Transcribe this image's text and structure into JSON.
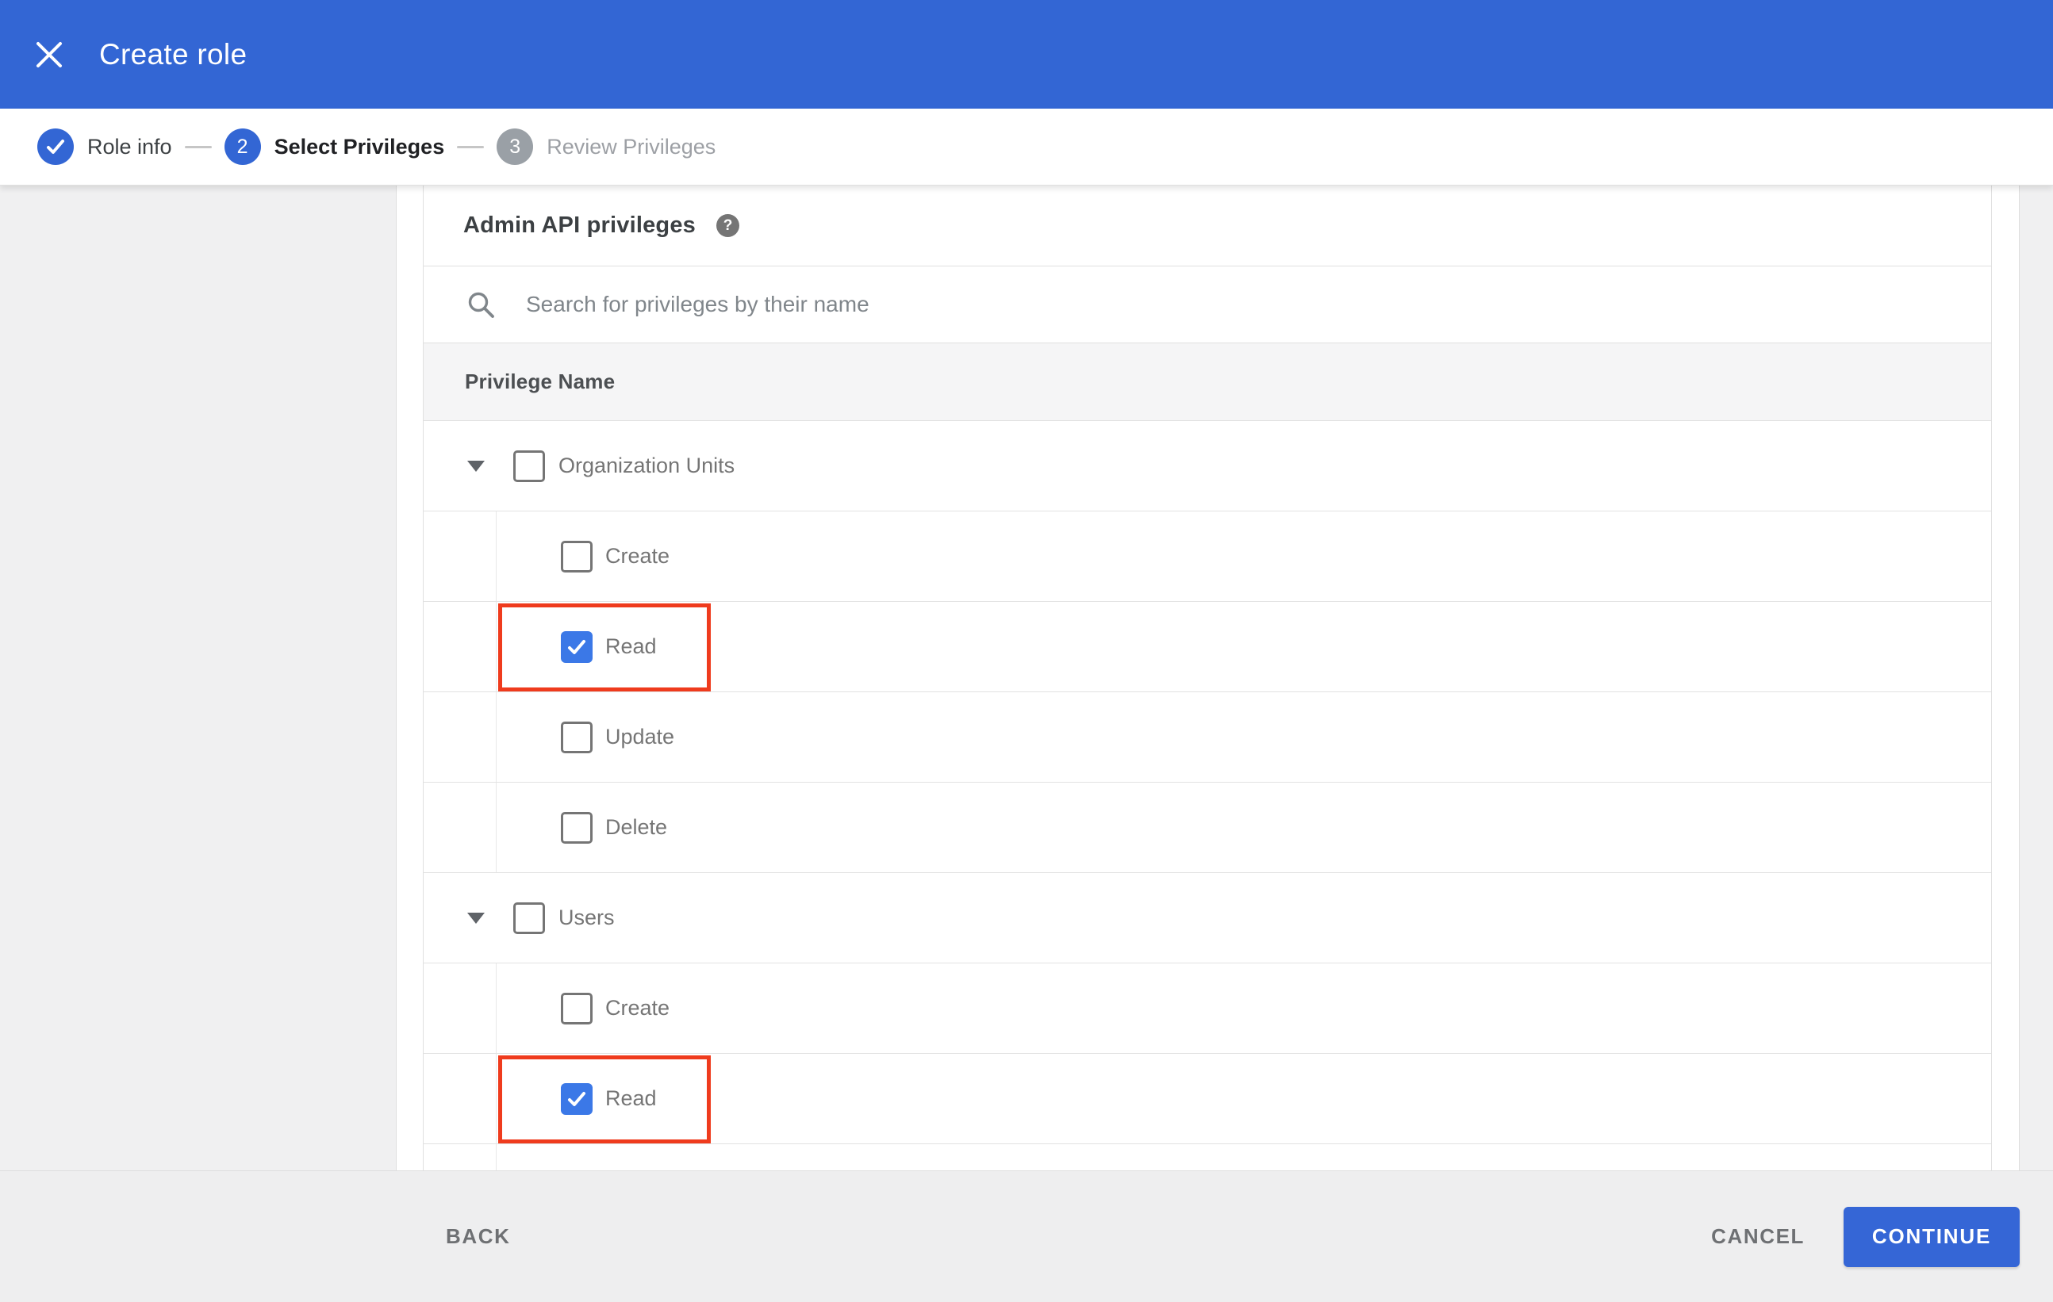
{
  "appbar": {
    "title": "Create role",
    "close_icon": "x-close",
    "background_color": "#3366d4"
  },
  "stepper": {
    "steps": [
      {
        "label": "Role info",
        "status": "done",
        "indicator": "check"
      },
      {
        "label": "Select Privileges",
        "status": "active",
        "number": "2"
      },
      {
        "label": "Review Privileges",
        "status": "upcoming",
        "number": "3"
      }
    ]
  },
  "panel": {
    "heading": "Admin API privileges",
    "help_icon": "?",
    "search": {
      "placeholder": "Search for privileges by their name",
      "value": "",
      "icon": "magnifier"
    },
    "column_header": "Privilege Name",
    "rows": [
      {
        "label": "Organization Units",
        "type": "parent",
        "expanded": true,
        "checked": false
      },
      {
        "label": "Create",
        "type": "child",
        "checked": false
      },
      {
        "label": "Read",
        "type": "child",
        "checked": true,
        "highlighted": true
      },
      {
        "label": "Update",
        "type": "child",
        "checked": false
      },
      {
        "label": "Delete",
        "type": "child",
        "checked": false
      },
      {
        "label": "Users",
        "type": "parent",
        "expanded": true,
        "checked": false
      },
      {
        "label": "Create",
        "type": "child",
        "checked": false
      },
      {
        "label": "Read",
        "type": "child",
        "checked": true,
        "highlighted": true
      }
    ]
  },
  "footer": {
    "back_label": "BACK",
    "cancel_label": "CANCEL",
    "continue_label": "CONTINUE"
  },
  "colors": {
    "appbar_blue": "#3366d4",
    "checkbox_blue": "#3b78e7",
    "highlight_red": "#ef3b1d",
    "continue_blue": "#3566d6"
  }
}
